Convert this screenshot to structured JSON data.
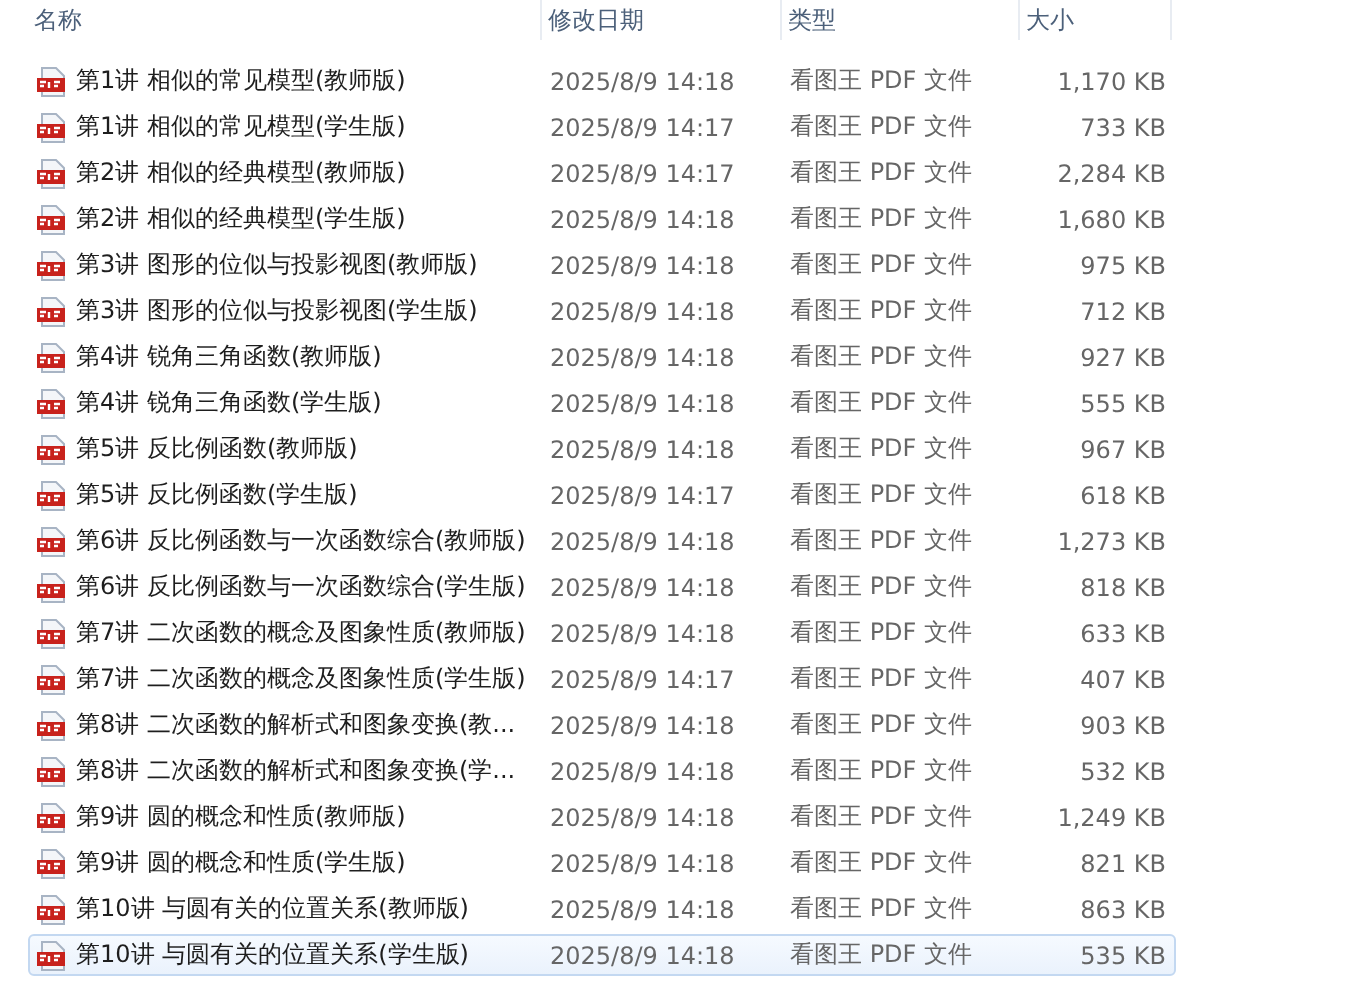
{
  "columns": [
    "名称",
    "修改日期",
    "类型",
    "大小"
  ],
  "files": [
    {
      "name": "第1讲 相似的常见模型(教师版)",
      "modified": "2025/8/9 14:18",
      "type": "看图王 PDF 文件",
      "size": "1,170 KB",
      "selected": false
    },
    {
      "name": "第1讲 相似的常见模型(学生版)",
      "modified": "2025/8/9 14:17",
      "type": "看图王 PDF 文件",
      "size": "733 KB",
      "selected": false
    },
    {
      "name": "第2讲 相似的经典模型(教师版)",
      "modified": "2025/8/9 14:17",
      "type": "看图王 PDF 文件",
      "size": "2,284 KB",
      "selected": false
    },
    {
      "name": "第2讲 相似的经典模型(学生版)",
      "modified": "2025/8/9 14:18",
      "type": "看图王 PDF 文件",
      "size": "1,680 KB",
      "selected": false
    },
    {
      "name": "第3讲 图形的位似与投影视图(教师版)",
      "modified": "2025/8/9 14:18",
      "type": "看图王 PDF 文件",
      "size": "975 KB",
      "selected": false
    },
    {
      "name": "第3讲 图形的位似与投影视图(学生版)",
      "modified": "2025/8/9 14:18",
      "type": "看图王 PDF 文件",
      "size": "712 KB",
      "selected": false
    },
    {
      "name": "第4讲 锐角三角函数(教师版)",
      "modified": "2025/8/9 14:18",
      "type": "看图王 PDF 文件",
      "size": "927 KB",
      "selected": false
    },
    {
      "name": "第4讲 锐角三角函数(学生版)",
      "modified": "2025/8/9 14:18",
      "type": "看图王 PDF 文件",
      "size": "555 KB",
      "selected": false
    },
    {
      "name": "第5讲 反比例函数(教师版)",
      "modified": "2025/8/9 14:18",
      "type": "看图王 PDF 文件",
      "size": "967 KB",
      "selected": false
    },
    {
      "name": "第5讲 反比例函数(学生版)",
      "modified": "2025/8/9 14:17",
      "type": "看图王 PDF 文件",
      "size": "618 KB",
      "selected": false
    },
    {
      "name": "第6讲 反比例函数与一次函数综合(教师版)",
      "modified": "2025/8/9 14:18",
      "type": "看图王 PDF 文件",
      "size": "1,273 KB",
      "selected": false
    },
    {
      "name": "第6讲 反比例函数与一次函数综合(学生版)",
      "modified": "2025/8/9 14:18",
      "type": "看图王 PDF 文件",
      "size": "818 KB",
      "selected": false
    },
    {
      "name": "第7讲 二次函数的概念及图象性质(教师版)",
      "modified": "2025/8/9 14:18",
      "type": "看图王 PDF 文件",
      "size": "633 KB",
      "selected": false
    },
    {
      "name": "第7讲 二次函数的概念及图象性质(学生版)",
      "modified": "2025/8/9 14:17",
      "type": "看图王 PDF 文件",
      "size": "407 KB",
      "selected": false
    },
    {
      "name": "第8讲 二次函数的解析式和图象变换(教...",
      "modified": "2025/8/9 14:18",
      "type": "看图王 PDF 文件",
      "size": "903 KB",
      "selected": false
    },
    {
      "name": "第8讲 二次函数的解析式和图象变换(学...",
      "modified": "2025/8/9 14:18",
      "type": "看图王 PDF 文件",
      "size": "532 KB",
      "selected": false
    },
    {
      "name": "第9讲 圆的概念和性质(教师版)",
      "modified": "2025/8/9 14:18",
      "type": "看图王 PDF 文件",
      "size": "1,249 KB",
      "selected": false
    },
    {
      "name": "第9讲 圆的概念和性质(学生版)",
      "modified": "2025/8/9 14:18",
      "type": "看图王 PDF 文件",
      "size": "821 KB",
      "selected": false
    },
    {
      "name": "第10讲 与圆有关的位置关系(教师版)",
      "modified": "2025/8/9 14:18",
      "type": "看图王 PDF 文件",
      "size": "863 KB",
      "selected": false
    },
    {
      "name": "第10讲 与圆有关的位置关系(学生版)",
      "modified": "2025/8/9 14:18",
      "type": "看图王 PDF 文件",
      "size": "535 KB",
      "selected": true
    }
  ]
}
